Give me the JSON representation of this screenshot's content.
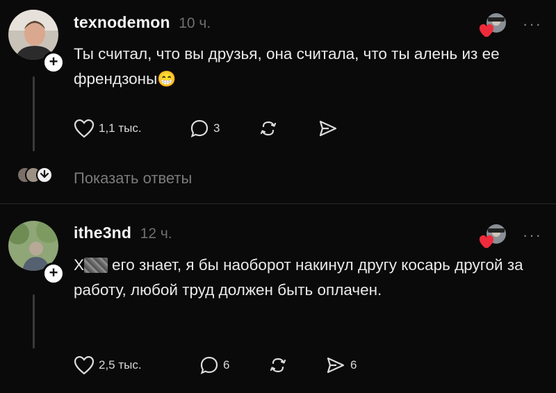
{
  "comments": [
    {
      "username": "texnodemon",
      "time": "10 ч.",
      "text": "Ты считал, что вы друзья, она считала, что ты алень из ее френдзоны",
      "emoji": "😁",
      "likes": "1,1 тыс.",
      "replies": "3",
      "shares": "",
      "show_replies": "Показать ответы"
    },
    {
      "username": "ithe3nd",
      "time": "12 ч.",
      "text_redacted_prefix": "Х",
      "text": "его знает, я бы наоборот накинул другу косарь другой за работу, любой труд должен быть оплачен.",
      "likes": "2,5 тыс.",
      "replies": "6",
      "shares": "6"
    }
  ],
  "icons": {
    "like": "heart-outline-icon",
    "reply": "speech-bubble-icon",
    "repost": "repost-icon",
    "share": "send-icon",
    "more": "more-dots-icon",
    "follow": "plus-icon",
    "chevron": "chevron-down-icon"
  },
  "more_label": "···",
  "follow_label": "+"
}
